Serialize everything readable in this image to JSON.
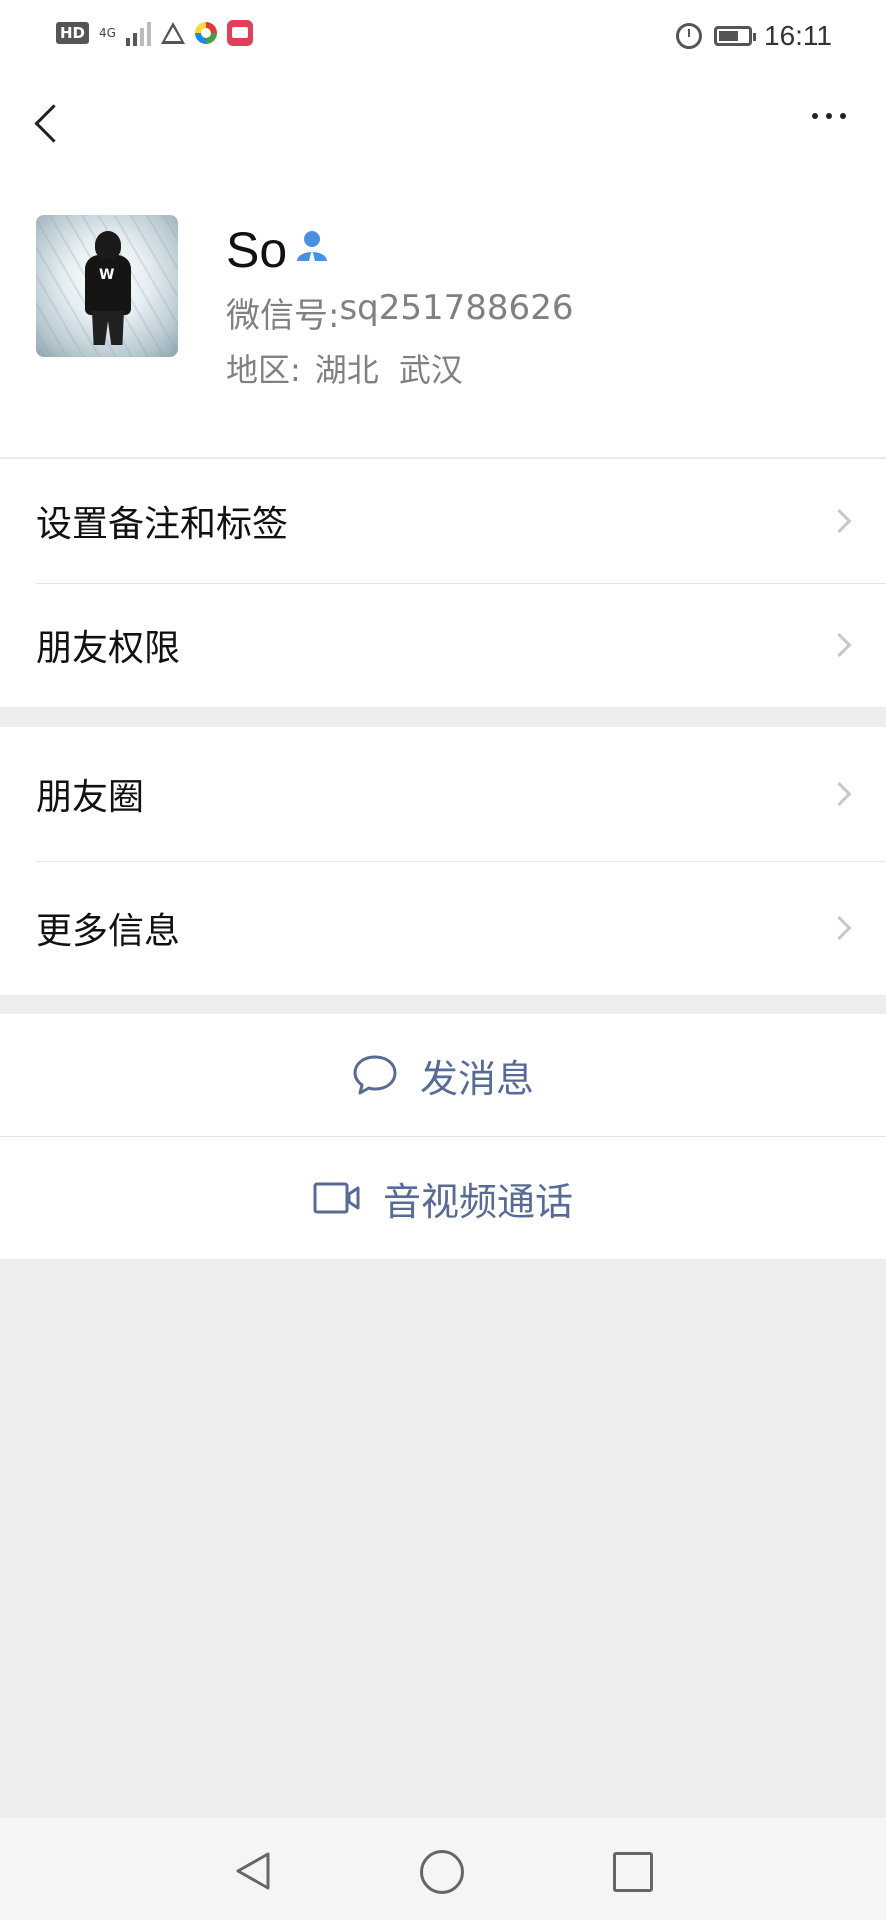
{
  "status_bar": {
    "hd": "HD",
    "network": "4G",
    "time": "16:11"
  },
  "profile": {
    "name": "So",
    "id_label": "微信号: ",
    "id_value": "sq251788626",
    "region_label": "地区: ",
    "region_province": "湖北",
    "region_city": "武汉"
  },
  "menu_group_1": [
    {
      "label": "设置备注和标签"
    },
    {
      "label": "朋友权限"
    }
  ],
  "menu_group_2": [
    {
      "label": "朋友圈"
    },
    {
      "label": "更多信息"
    }
  ],
  "actions": {
    "send_message": "发消息",
    "av_call": "音视频通话"
  },
  "colors": {
    "link": "#576b95",
    "badge": "#4a90e2",
    "background": "#ededed"
  }
}
